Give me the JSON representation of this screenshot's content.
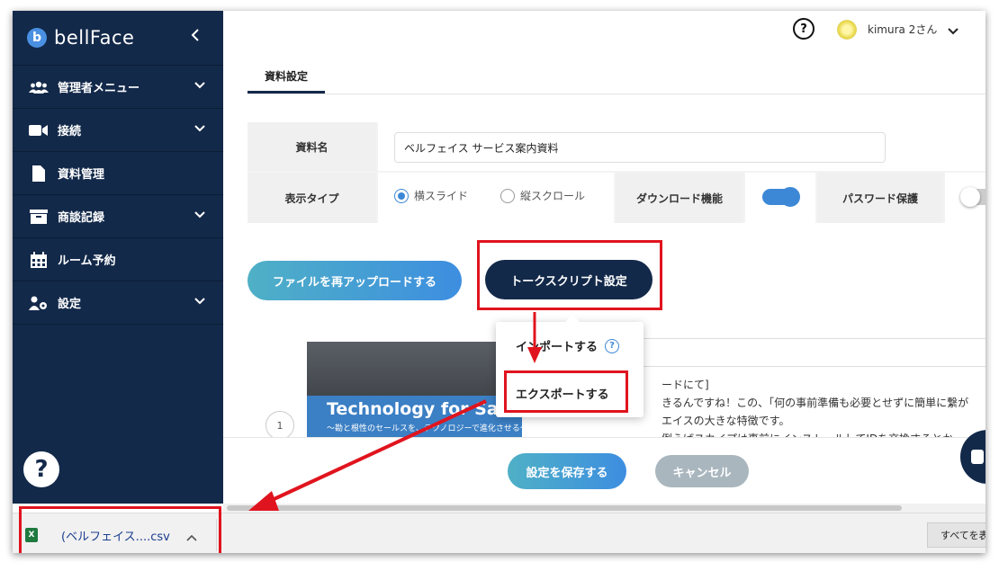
{
  "sidebar": {
    "logo_mark": "b",
    "logo_text": "bellFace",
    "items": [
      {
        "label": "管理者メニュー",
        "icon": "users-icon",
        "has_chevron": true
      },
      {
        "label": "接続",
        "icon": "video-camera-icon",
        "has_chevron": true
      },
      {
        "label": "資料管理",
        "icon": "document-icon",
        "has_chevron": false
      },
      {
        "label": "商談記録",
        "icon": "archive-box-icon",
        "has_chevron": true
      },
      {
        "label": "ルーム予約",
        "icon": "calendar-icon",
        "has_chevron": false
      },
      {
        "label": "設定",
        "icon": "user-gear-icon",
        "has_chevron": true
      }
    ],
    "help": "?"
  },
  "header": {
    "help": "?",
    "user_name": "kimura 2さん"
  },
  "tabs": [
    "資料設定"
  ],
  "form": {
    "name_label": "資料名",
    "name_value": "ベルフェイス サービス案内資料",
    "display_type_label": "表示タイプ",
    "display_options": [
      "横スライド",
      "縦スクロール"
    ],
    "download_label": "ダウンロード機能",
    "password_label": "パスワード保護"
  },
  "buttons": {
    "reupload": "ファイルを再アップロードする",
    "talk_script": "トークスクリプト設定",
    "save": "設定を保存する",
    "cancel": "キャンセル"
  },
  "dropdown": {
    "import": "インポートする",
    "help": "?",
    "export": "エクスポートする"
  },
  "slide": {
    "number": "1",
    "thumb_title": "Technology for Sales",
    "thumb_subtitle": "〜勘と根性のセールスを、テクノロジーで進化させる〜",
    "script_lines": [
      "ードにて]",
      "きるんですね！この、「何の事前準備も必要とせずに簡単に繋が",
      "エイスの大きな特徴です。",
      "例えばスカイプは事前にインストールしてIDを交換するとか、appear.inはブラウ"
    ]
  },
  "download": {
    "file_label": "(ベルフェイス....csv",
    "file_icon": "X",
    "show_all": "すべてを表"
  },
  "colors": {
    "sidebar": "#13294a",
    "accent": "#3d8ee0",
    "highlight": "#e0141e"
  }
}
